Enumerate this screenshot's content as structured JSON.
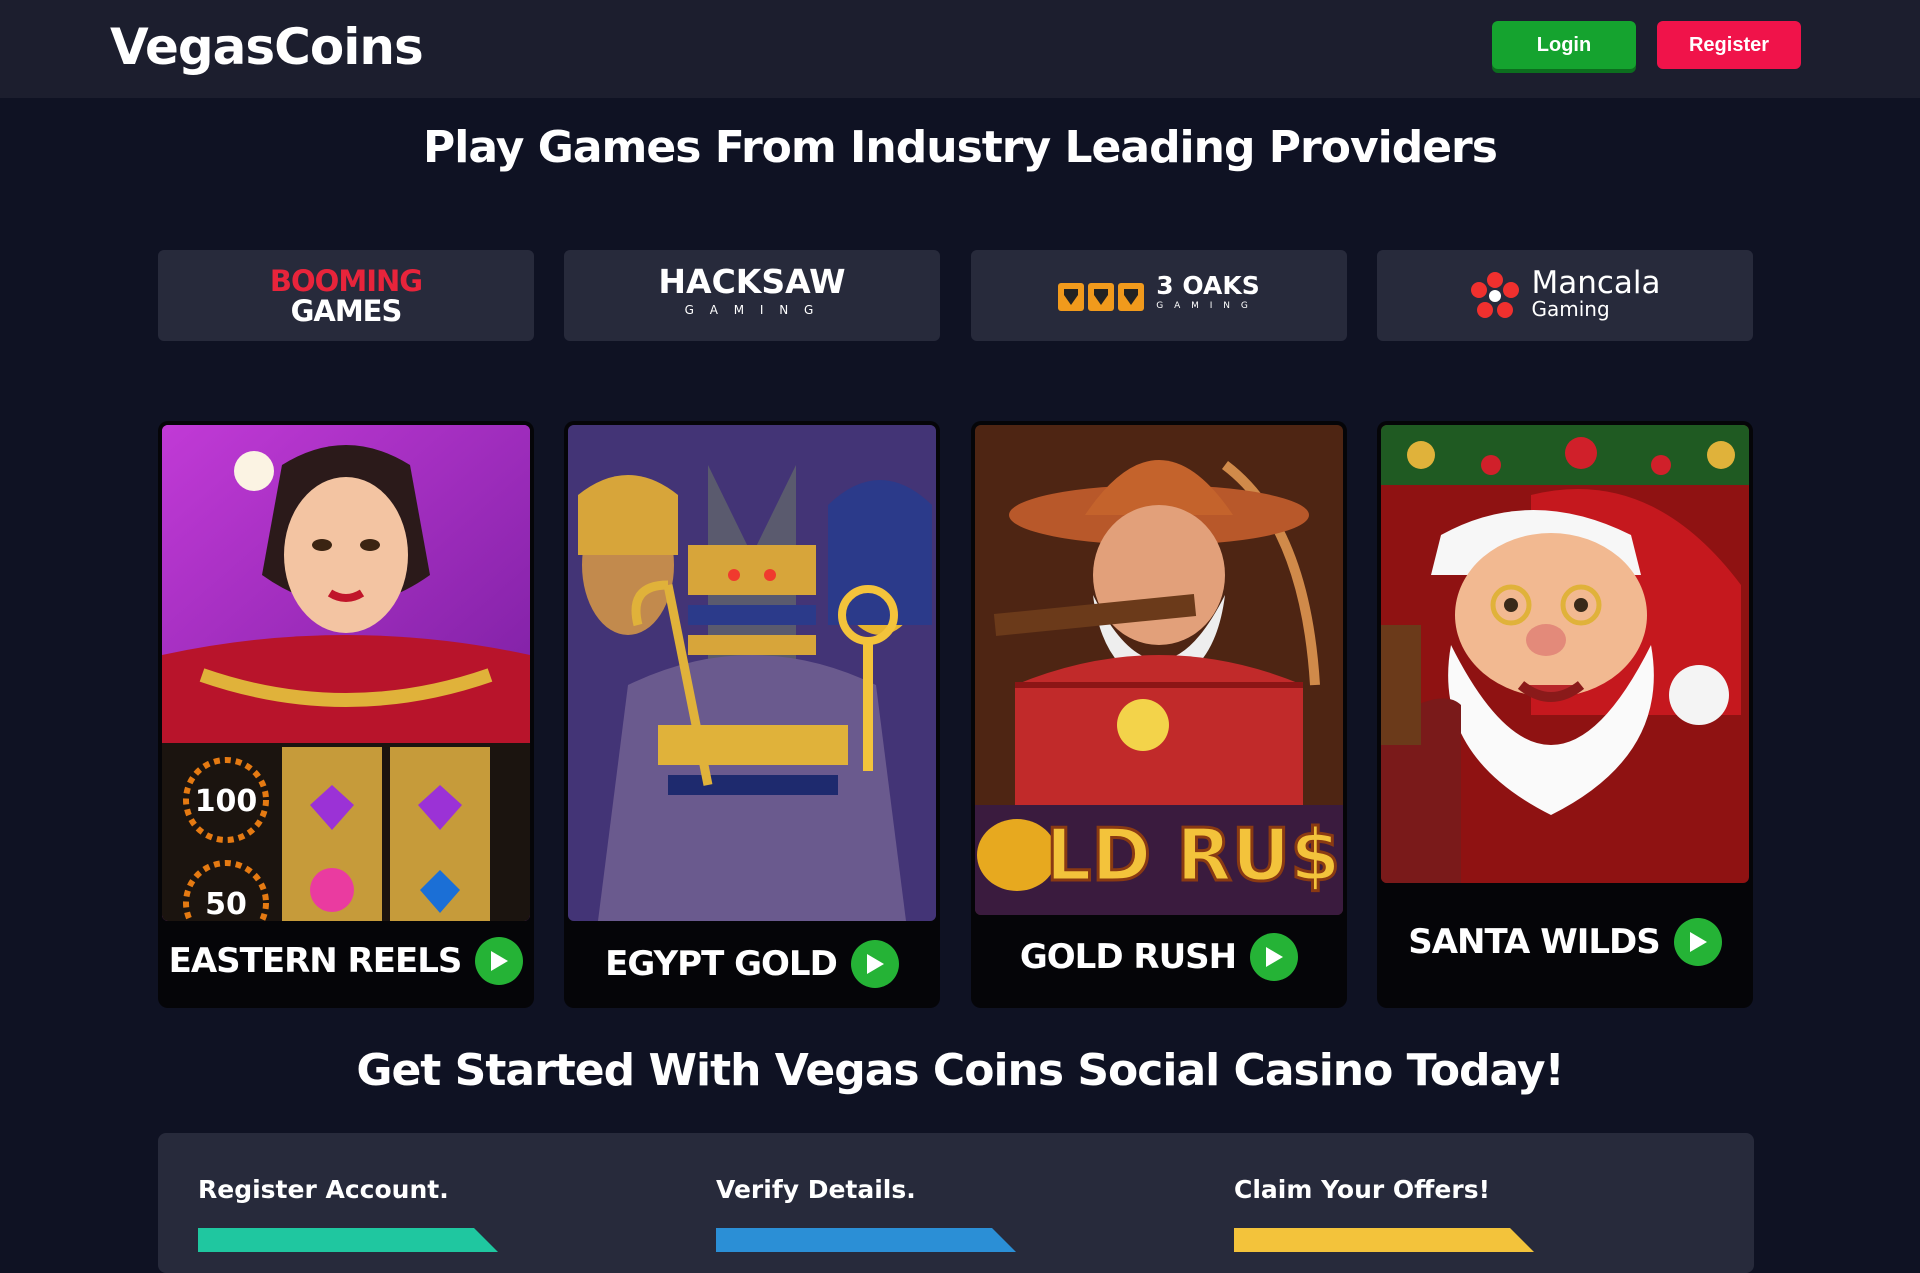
{
  "header": {
    "logo": "VegasCoins",
    "login_label": "Login",
    "register_label": "Register"
  },
  "providers_section": {
    "title": "Play Games From Industry Leading Providers",
    "providers": [
      {
        "line1": "BOOMING",
        "line2": "GAMES"
      },
      {
        "line1": "HACKSAW",
        "line2": "G A M I N G"
      },
      {
        "line1": "3 OAKS",
        "line2": "G A M I N G"
      },
      {
        "line1": "Mancala",
        "line2": "Gaming"
      }
    ]
  },
  "games": [
    {
      "name": "EASTERN REELS",
      "badge_top": "100",
      "badge_bottom": "50"
    },
    {
      "name": "EGYPT GOLD"
    },
    {
      "name": "GOLD RUSH",
      "banner": "LD RU$"
    },
    {
      "name": "SANTA WILDS"
    }
  ],
  "get_started": {
    "title": "Get Started With Vegas Coins Social Casino Today!",
    "steps": [
      {
        "label": "Register Account.",
        "color": "#1fc7a0"
      },
      {
        "label": "Verify Details.",
        "color": "#2b8fd6"
      },
      {
        "label": "Claim Your Offers!",
        "color": "#f3c33b"
      }
    ]
  },
  "colors": {
    "background": "#0f1223",
    "header": "#1c1e2e",
    "card": "#272a3b",
    "login_green": "#15a32f",
    "register_red": "#f0134a",
    "play_green": "#25b336"
  }
}
